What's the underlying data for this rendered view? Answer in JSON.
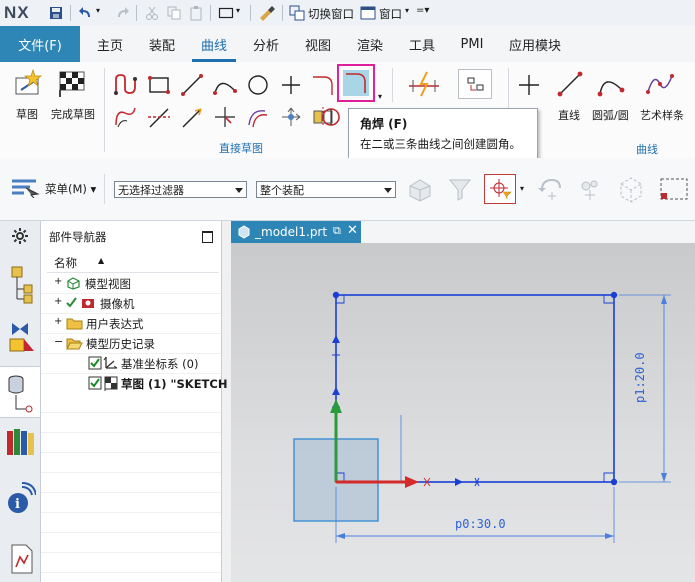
{
  "app": {
    "logo": "NX"
  },
  "quick_access": {
    "switch_window": "切换窗口",
    "window": "窗口"
  },
  "menu": {
    "file": "文件(F)",
    "tabs": [
      "主页",
      "装配",
      "曲线",
      "分析",
      "视图",
      "渲染",
      "工具",
      "PMI",
      "应用模块"
    ],
    "active_tab": "曲线"
  },
  "ribbon": {
    "sketch": "草图",
    "finish_sketch": "完成草图",
    "group_direct_sketch": "直接草图",
    "line": "直线",
    "arc_circle": "圆弧/圆",
    "art_spline": "艺术样条",
    "group_curve": "曲线"
  },
  "tooltip": {
    "title": "角焊 (F)",
    "description": "在二或三条曲线之间创建圆角。"
  },
  "filterbar": {
    "menu_label": "菜单(M)",
    "filter_value": "无选择过滤器",
    "assembly_value": "整个装配"
  },
  "navigator": {
    "title": "部件导航器",
    "column_name": "名称",
    "items": [
      {
        "label": "模型视图"
      },
      {
        "label": "摄像机"
      },
      {
        "label": "用户表达式"
      },
      {
        "label": "模型历史记录"
      },
      {
        "label": "基准坐标系 (0)"
      },
      {
        "label": "草图 (1) \"SKETCH"
      }
    ]
  },
  "graphics": {
    "tab_title": "_model1.prt",
    "dim_width": "p0:30.0",
    "dim_height": "p1:20.0"
  },
  "colors": {
    "accent": "#2e86b6",
    "tab_active": "#1e6fae",
    "highlight": "#e0209a",
    "sketch": "#1a3fd6"
  }
}
